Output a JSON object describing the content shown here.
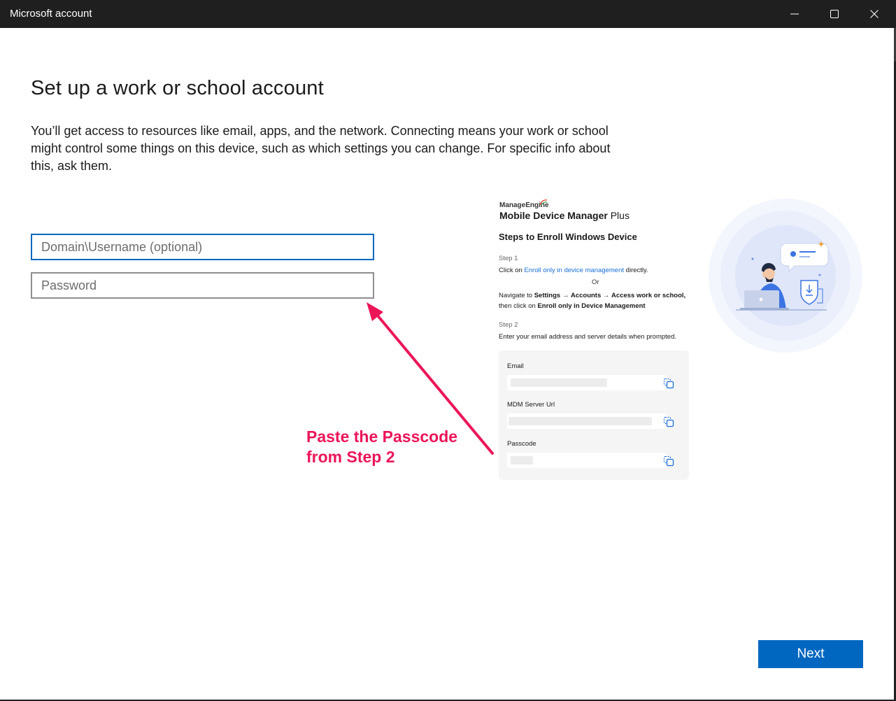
{
  "window": {
    "title": "Microsoft account",
    "controls": [
      "minimize-icon",
      "maximize-icon",
      "close-icon"
    ]
  },
  "page": {
    "heading": "Set up a work or school account",
    "description": "You’ll get access to resources like email, apps, and the network. Connecting means your work or school might control some things on this device, such as which settings you can change. For specific info about this, ask them."
  },
  "form": {
    "username_placeholder": "Domain\\Username (optional)",
    "username_value": "",
    "password_placeholder": "Password",
    "password_value": ""
  },
  "annotation": {
    "line1": "Paste the Passcode",
    "line2": "from Step 2",
    "color": "#eb1558"
  },
  "guide": {
    "brand": "ManageEngine",
    "product": "Mobile Device Manager",
    "product_suffix": "Plus",
    "title": "Steps to Enroll Windows Device",
    "step1_label": "Step 1",
    "step1_prefix": "Click on",
    "step1_link": "Enroll only in device management",
    "step1_suffix": "directly.",
    "or_text": "Or",
    "nav_prefix": "Navigate to",
    "nav_settings": "Settings",
    "nav_arrow": "→",
    "nav_accounts": "Accounts",
    "nav_access": "Access work or school,",
    "nav_then": "then click on",
    "nav_enroll": "Enroll only in Device Management",
    "step2_label": "Step 2",
    "step2_text": "Enter your email address and server details when prompted.",
    "fields": [
      {
        "label": "Email"
      },
      {
        "label": "MDM Server Url"
      },
      {
        "label": "Passcode"
      }
    ]
  },
  "footer": {
    "next_label": "Next"
  },
  "colors": {
    "titlebar": "#1f1f1f",
    "accent": "#0067c0",
    "link": "#1a6fd6"
  }
}
